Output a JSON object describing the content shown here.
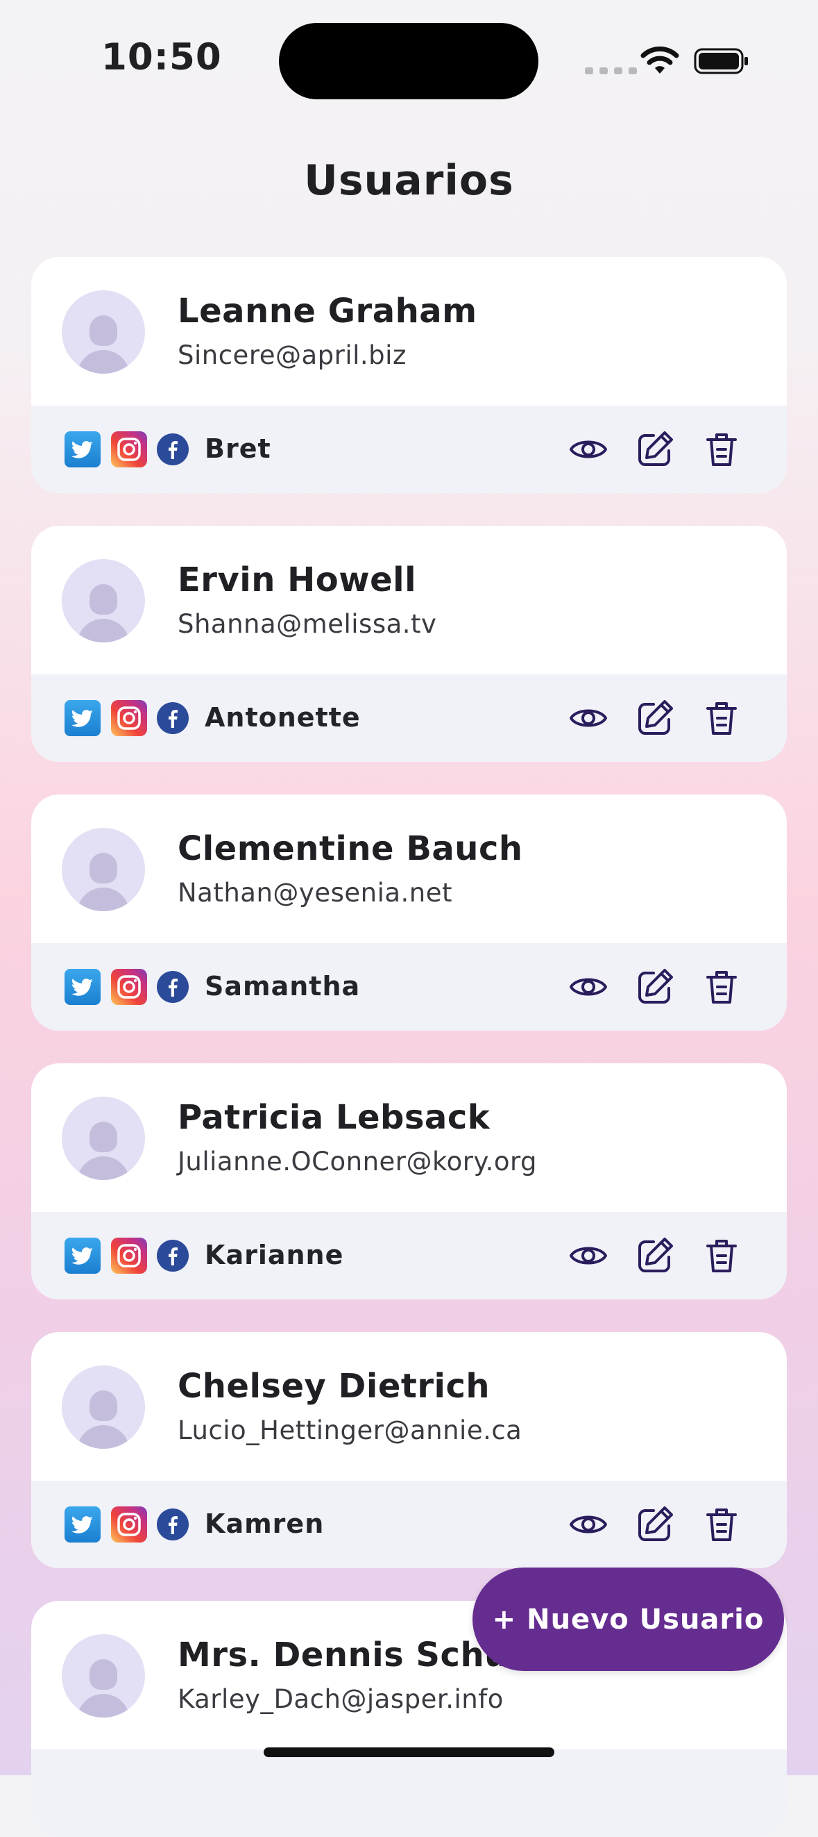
{
  "status": {
    "time": "10:50"
  },
  "header": {
    "title": "Usuarios"
  },
  "users": [
    {
      "name": "Leanne Graham",
      "email": "Sincere@april.biz",
      "username": "Bret"
    },
    {
      "name": "Ervin Howell",
      "email": "Shanna@melissa.tv",
      "username": "Antonette"
    },
    {
      "name": "Clementine Bauch",
      "email": "Nathan@yesenia.net",
      "username": "Samantha"
    },
    {
      "name": "Patricia Lebsack",
      "email": "Julianne.OConner@kory.org",
      "username": "Karianne"
    },
    {
      "name": "Chelsey Dietrich",
      "email": "Lucio_Hettinger@annie.ca",
      "username": "Kamren"
    },
    {
      "name": "Mrs. Dennis Schulist",
      "email": "Karley_Dach@jasper.info",
      "username": ""
    }
  ],
  "fab": {
    "label": "+ Nuevo Usuario"
  },
  "colors": {
    "accent": "#662d91",
    "icon_stroke": "#2a1d5c",
    "card_footer": "#f1f2f8",
    "avatar_bg": "#e3dff4"
  },
  "icons": [
    "twitter-icon",
    "instagram-icon",
    "facebook-icon",
    "eye-icon",
    "edit-icon",
    "trash-icon"
  ]
}
